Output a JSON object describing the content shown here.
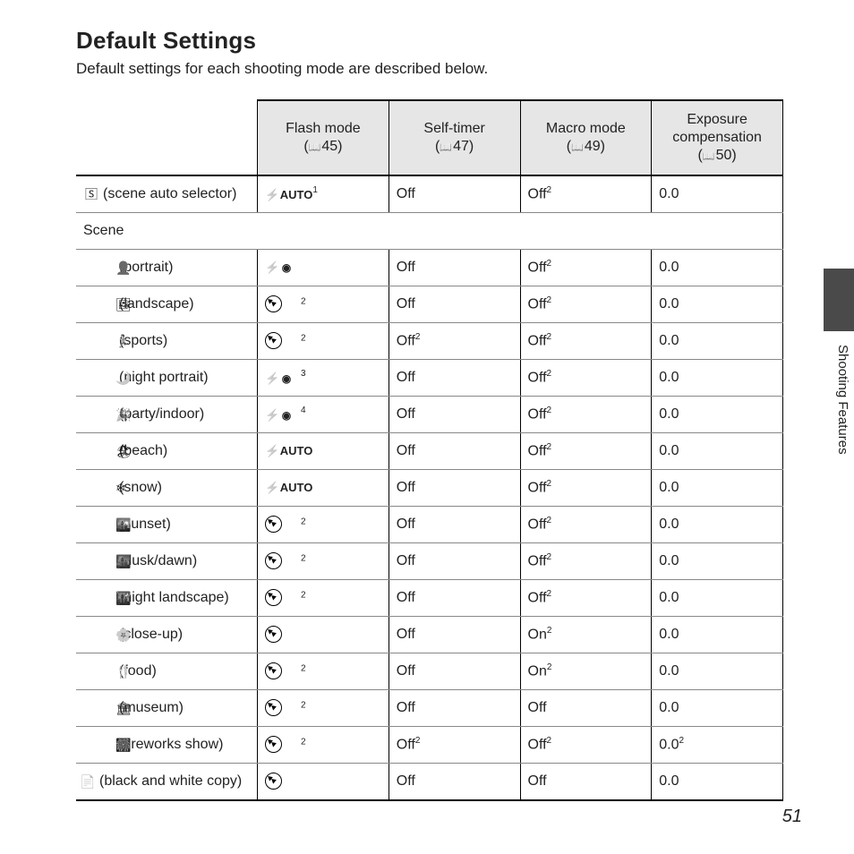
{
  "title": "Default Settings",
  "intro": "Default settings for each shooting mode are described below.",
  "side_label": "Shooting Features",
  "page_number": "51",
  "headers": {
    "flash": {
      "line1": "Flash mode",
      "ref": "45"
    },
    "timer": {
      "line1": "Self-timer",
      "ref": "47"
    },
    "macro": {
      "line1": "Macro mode",
      "ref": "49"
    },
    "exp": {
      "line1": "Exposure",
      "line2": "compensation",
      "ref": "50"
    }
  },
  "scene_label": "Scene",
  "rows": [
    {
      "id": "scene-auto",
      "icon": "🅂",
      "label": "(scene auto selector)",
      "top": true,
      "flash": {
        "kind": "bolt-auto",
        "fn": "1"
      },
      "timer": {
        "t": "Off"
      },
      "macro": {
        "t": "Off",
        "fn": "2"
      },
      "exp": {
        "t": "0.0"
      }
    },
    {
      "id": "portrait",
      "icon": "👤",
      "label": "(portrait)",
      "flash": {
        "kind": "bolt-redeye"
      },
      "timer": {
        "t": "Off"
      },
      "macro": {
        "t": "Off",
        "fn": "2"
      },
      "exp": {
        "t": "0.0"
      }
    },
    {
      "id": "landscape",
      "icon": "🖼",
      "label": "(landscape)",
      "flash": {
        "kind": "circ-off",
        "fn": "2"
      },
      "timer": {
        "t": "Off"
      },
      "macro": {
        "t": "Off",
        "fn": "2"
      },
      "exp": {
        "t": "0.0"
      }
    },
    {
      "id": "sports",
      "icon": "🏃",
      "label": "(sports)",
      "flash": {
        "kind": "circ-off",
        "fn": "2"
      },
      "timer": {
        "t": "Off",
        "fn": "2"
      },
      "macro": {
        "t": "Off",
        "fn": "2"
      },
      "exp": {
        "t": "0.0"
      }
    },
    {
      "id": "night-portrait",
      "icon": "🌙",
      "label": "(night portrait)",
      "flash": {
        "kind": "bolt-redeye",
        "fn": "3"
      },
      "timer": {
        "t": "Off"
      },
      "macro": {
        "t": "Off",
        "fn": "2"
      },
      "exp": {
        "t": "0.0"
      }
    },
    {
      "id": "party",
      "icon": "🎉",
      "label": "(party/indoor)",
      "flash": {
        "kind": "bolt-redeye",
        "fn": "4"
      },
      "timer": {
        "t": "Off"
      },
      "macro": {
        "t": "Off",
        "fn": "2"
      },
      "exp": {
        "t": "0.0"
      }
    },
    {
      "id": "beach",
      "icon": "🏖",
      "label": "(beach)",
      "flash": {
        "kind": "bolt-auto"
      },
      "timer": {
        "t": "Off"
      },
      "macro": {
        "t": "Off",
        "fn": "2"
      },
      "exp": {
        "t": "0.0"
      }
    },
    {
      "id": "snow",
      "icon": "❄",
      "label": "(snow)",
      "flash": {
        "kind": "bolt-auto"
      },
      "timer": {
        "t": "Off"
      },
      "macro": {
        "t": "Off",
        "fn": "2"
      },
      "exp": {
        "t": "0.0"
      }
    },
    {
      "id": "sunset",
      "icon": "🌇",
      "label": "(sunset)",
      "flash": {
        "kind": "circ-off",
        "fn": "2"
      },
      "timer": {
        "t": "Off"
      },
      "macro": {
        "t": "Off",
        "fn": "2"
      },
      "exp": {
        "t": "0.0"
      }
    },
    {
      "id": "dusk",
      "icon": "🌆",
      "label": "(dusk/dawn)",
      "flash": {
        "kind": "circ-off",
        "fn": "2"
      },
      "timer": {
        "t": "Off"
      },
      "macro": {
        "t": "Off",
        "fn": "2"
      },
      "exp": {
        "t": "0.0"
      }
    },
    {
      "id": "night-land",
      "icon": "🌃",
      "label": "(night landscape)",
      "flash": {
        "kind": "circ-off",
        "fn": "2"
      },
      "timer": {
        "t": "Off"
      },
      "macro": {
        "t": "Off",
        "fn": "2"
      },
      "exp": {
        "t": "0.0"
      }
    },
    {
      "id": "closeup",
      "icon": "🌸",
      "label": "(close-up)",
      "flash": {
        "kind": "circ-off"
      },
      "timer": {
        "t": "Off"
      },
      "macro": {
        "t": "On",
        "fn": "2"
      },
      "exp": {
        "t": "0.0"
      }
    },
    {
      "id": "food",
      "icon": "🍴",
      "label": "(food)",
      "flash": {
        "kind": "circ-off",
        "fn": "2"
      },
      "timer": {
        "t": "Off"
      },
      "macro": {
        "t": "On",
        "fn": "2"
      },
      "exp": {
        "t": "0.0"
      }
    },
    {
      "id": "museum",
      "icon": "🏛",
      "label": "(museum)",
      "flash": {
        "kind": "circ-off",
        "fn": "2"
      },
      "timer": {
        "t": "Off"
      },
      "macro": {
        "t": "Off"
      },
      "exp": {
        "t": "0.0"
      }
    },
    {
      "id": "fireworks",
      "icon": "🎆",
      "label": "(fireworks show)",
      "flash": {
        "kind": "circ-off",
        "fn": "2"
      },
      "timer": {
        "t": "Off",
        "fn": "2"
      },
      "macro": {
        "t": "Off",
        "fn": "2"
      },
      "exp": {
        "t": "0.0",
        "fn": "2"
      }
    },
    {
      "id": "bw-copy",
      "icon": "📄",
      "label": "(black and white copy)",
      "wrap": true,
      "flash": {
        "kind": "circ-off"
      },
      "timer": {
        "t": "Off"
      },
      "macro": {
        "t": "Off"
      },
      "exp": {
        "t": "0.0"
      }
    }
  ]
}
